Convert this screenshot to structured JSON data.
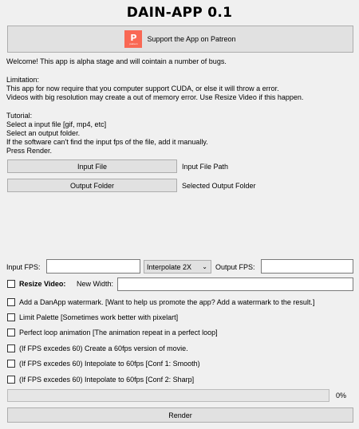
{
  "app": {
    "title": "DAIN-APP 0.1"
  },
  "patreon": {
    "label": "Support the App on Patreon",
    "logo_text": "patreon",
    "brand_color": "#f96854"
  },
  "intro": {
    "welcome": "Welcome! This app is alpha stage and will cointain a number of bugs.",
    "limitation_heading": "Limitation:",
    "limitation_1": "This app for now require that you computer support CUDA, or else it will throw a error.",
    "limitation_2": "Videos with big resolution may create a out of memory error. Use Resize Video if this happen.",
    "tutorial_heading": "Tutorial:",
    "tutorial_1": "Select a input file [gif, mp4, etc]",
    "tutorial_2": "Select an output folder.",
    "tutorial_3": "If the software can't find the input fps of the file, add it manually.",
    "tutorial_4": "Press Render."
  },
  "input_file": {
    "button": "Input File",
    "path": "Input File Path"
  },
  "output_folder": {
    "button": "Output Folder",
    "path": "Selected Output Folder"
  },
  "fps": {
    "input_label": "Input FPS:",
    "input_value": "",
    "interpolate_selected": "Interpolate 2X",
    "output_label": "Output FPS:",
    "output_value": ""
  },
  "resize": {
    "label": "Resize Video:",
    "width_label": "New Width:",
    "width_value": "",
    "checked": false
  },
  "options": [
    {
      "label": "Add a DanApp watermark. [Want to help us promote the app? Add a watermark to the result.]",
      "checked": false
    },
    {
      "label": "Limit Palette [Sometimes work better with pixelart]",
      "checked": false
    },
    {
      "label": "Perfect loop animation [The animation repeat in a perfect loop]",
      "checked": false
    },
    {
      "label": "(If FPS excedes 60) Create a 60fps version of movie.",
      "checked": false
    },
    {
      "label": "(If FPS excedes 60) Intepolate to 60fps [Conf 1: Smooth)",
      "checked": false
    },
    {
      "label": "(If FPS excedes 60) Intepolate to 60fps [Conf 2: Sharp]",
      "checked": false
    }
  ],
  "progress": {
    "value": 0,
    "text": "0%"
  },
  "render": {
    "label": "Render"
  }
}
